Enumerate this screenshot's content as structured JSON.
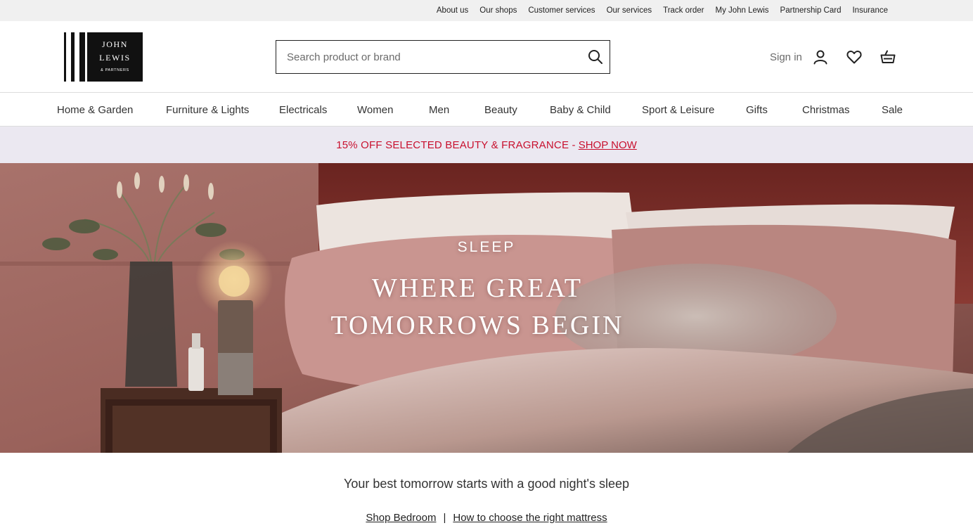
{
  "utility_nav": {
    "links": [
      "About us",
      "Our shops",
      "Customer services",
      "Our services",
      "Track order",
      "My John Lewis",
      "Partnership Card",
      "Insurance"
    ]
  },
  "brand": {
    "line1": "JOHN",
    "line2": "LEWIS",
    "line3": "& PARTNERS"
  },
  "search": {
    "placeholder": "Search product or brand",
    "value": ""
  },
  "account": {
    "sign_in_label": "Sign in"
  },
  "icons": {
    "search": "search-icon",
    "account": "user-icon",
    "wishlist": "heart-icon",
    "basket": "basket-icon"
  },
  "main_nav": {
    "items": [
      "Home & Garden",
      "Furniture & Lights",
      "Electricals",
      "Women",
      "Men",
      "Beauty",
      "Baby & Child",
      "Sport & Leisure",
      "Gifts",
      "Christmas",
      "Sale"
    ]
  },
  "promo": {
    "text": "15% OFF SELECTED BEAUTY & FRAGRANCE -",
    "link": "SHOP NOW",
    "color": "#c8102e",
    "background": "#ebe8f1"
  },
  "hero": {
    "eyebrow": "SLEEP",
    "title": "WHERE GREAT TOMORROWS BEGIN"
  },
  "intro": {
    "text": "Your best tomorrow starts with a good night's sleep"
  },
  "links": {
    "shop_bedroom": "Shop Bedroom",
    "separator": "|",
    "mattress_guide": "How to choose the right mattress"
  }
}
